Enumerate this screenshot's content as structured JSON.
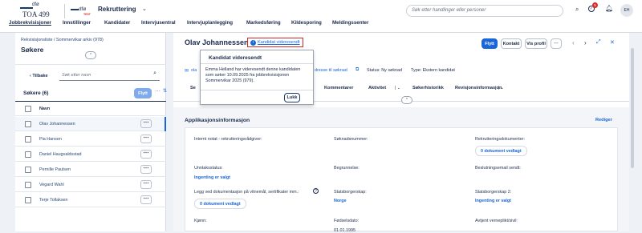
{
  "logo": {
    "top_text": "dfø",
    "sub_text": "TOA 499",
    "test_text": "dfø",
    "test_badge": "TEST"
  },
  "app_title": "Rekruttering",
  "nav": [
    "Jobbrekvisisjoner",
    "Innstillinger",
    "Kandidater",
    "Intervjusentral",
    "Intervjuplanlegging",
    "Markedsføring",
    "Kildesporing",
    "Meldingssenter"
  ],
  "search": {
    "placeholder": "Søk etter handlinger eller personer"
  },
  "notif_count": "5",
  "avatar": "EH",
  "left": {
    "breadcrumb": "Rekvisisjonsliste / Sommervikar arkiv (978)",
    "title": "Søkere",
    "back": "Tilbake",
    "search_placeholder": "Søk etter navn",
    "count_label": "Søkere (6)",
    "move": "Flytt",
    "header_name": "Navn",
    "applicants": [
      "Olav Johannessen",
      "Pia Hansen",
      "Daniel Haugvaldsstad",
      "Pernille Paulsen",
      "Vegard Wahl",
      "Terje Tollaksen"
    ]
  },
  "candidate": {
    "name": "Olav Johannessen",
    "status_link": "Kandidat videresendt",
    "email": "ola",
    "address": "dresse til søknad",
    "status": "Status: Ny søknad",
    "type": "Type: Ekstern kandidat"
  },
  "actions": {
    "move": "Flytt",
    "contact": "Kontakt",
    "profile": "Vis profil"
  },
  "tabs": [
    "Se",
    "Kommentarer",
    "Aktivitet",
    "Søkerhistorikk",
    "Revisjonsinformasjon"
  ],
  "popup": {
    "title": "Kandidat videresendt",
    "body": "Emma Helland har videresendt denne kandidaten som søker 10.09.2025 fra jobbrekvisisjonen Sommervikar 2025 (979).",
    "close": "Lukk"
  },
  "section": {
    "title": "Applikasjonsinformasjon",
    "edit": "Rediger"
  },
  "fields": {
    "internal_note": "Internt notat - rekrutteringsrådgiver:",
    "app_number": "Søknadsnummer:",
    "rec_docs": "Rekrutteringsdokumenter:",
    "rec_docs_val": "0 dokument vedlagt",
    "exception": "Unntaksstatus:",
    "exception_val": "Ingenting er valgt",
    "justification": "Begrunnelse:",
    "rejection_email": "Beslutningsemail sendt:",
    "docs": "Legg ved dokumentasjon på vitnemål, sertifikater mm.:",
    "docs_val": "0 dokument vedlagt",
    "citizenship": "Statsborgerskap:",
    "citizenship_val": "Norge",
    "citizenship2": "Statsborgerskap 2:",
    "citizenship2_val": "Ingenting er valgt",
    "gender": "Kjønn:",
    "birthdate": "Fødselsdato:",
    "birthdate_val": "01.01.1995",
    "military": "Avtjent verneplikt/sivil:"
  }
}
